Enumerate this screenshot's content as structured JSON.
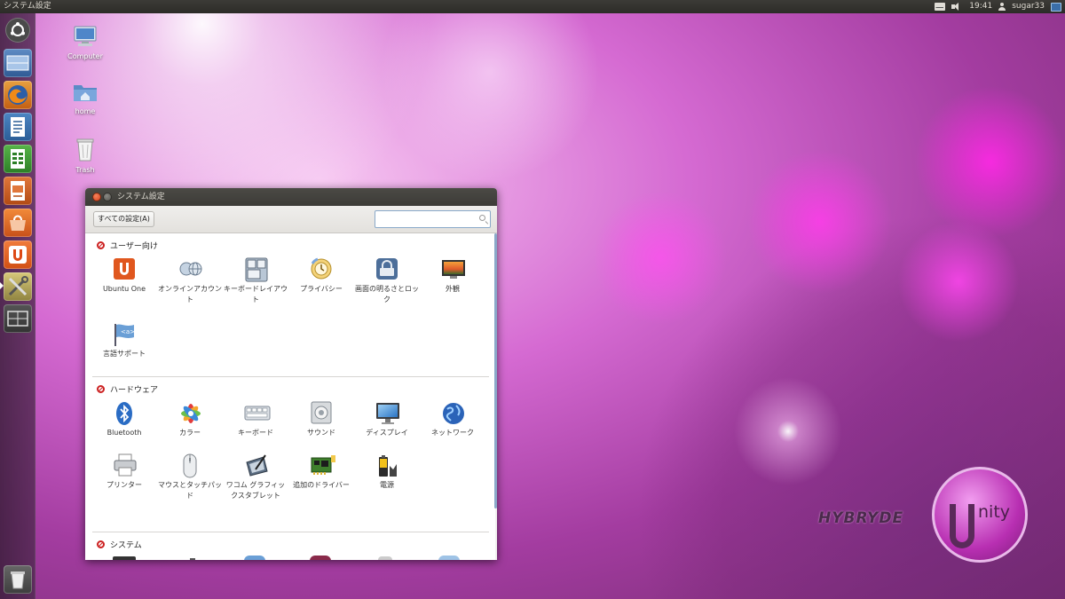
{
  "top_panel": {
    "window_title": "システム設定",
    "time": "19:41",
    "user": "sugar33"
  },
  "launcher": {
    "items": [
      {
        "name": "dash-home"
      },
      {
        "name": "workspace-switcher"
      },
      {
        "name": "firefox"
      },
      {
        "name": "libreoffice-writer"
      },
      {
        "name": "libreoffice-calc"
      },
      {
        "name": "libreoffice-impress"
      },
      {
        "name": "ubuntu-software-center"
      },
      {
        "name": "ubuntu-one"
      },
      {
        "name": "system-settings"
      },
      {
        "name": "workspaces"
      },
      {
        "name": "trash"
      }
    ]
  },
  "desktop": {
    "icons": [
      {
        "label": "Computer"
      },
      {
        "label": "home"
      },
      {
        "label": "Trash"
      }
    ],
    "logo_text": "HYBRYDE",
    "logo_word": "nity"
  },
  "window": {
    "title": "システム設定",
    "all_settings_label": "すべての設定(A)",
    "search_placeholder": "",
    "sections": [
      {
        "title": "ユーザー向け",
        "items": [
          {
            "label": "Ubuntu One",
            "icon": "ubuntu-one-icon"
          },
          {
            "label": "オンラインアカウント",
            "icon": "online-accounts-icon"
          },
          {
            "label": "キーボードレイアウト",
            "icon": "keyboard-layout-icon"
          },
          {
            "label": "プライバシー",
            "icon": "privacy-icon"
          },
          {
            "label": "画面の明るさとロック",
            "icon": "brightness-lock-icon"
          },
          {
            "label": "外観",
            "icon": "appearance-icon"
          },
          {
            "label": "言語サポート",
            "icon": "language-support-icon"
          }
        ]
      },
      {
        "title": "ハードウェア",
        "items": [
          {
            "label": "Bluetooth",
            "icon": "bluetooth-icon"
          },
          {
            "label": "カラー",
            "icon": "color-icon"
          },
          {
            "label": "キーボード",
            "icon": "keyboard-icon"
          },
          {
            "label": "サウンド",
            "icon": "sound-icon"
          },
          {
            "label": "ディスプレイ",
            "icon": "display-icon"
          },
          {
            "label": "ネットワーク",
            "icon": "network-icon"
          },
          {
            "label": "プリンター",
            "icon": "printer-icon"
          },
          {
            "label": "マウスとタッチパッド",
            "icon": "mouse-icon"
          },
          {
            "label": "ワコム グラフィックスタブレット",
            "icon": "tablet-icon"
          },
          {
            "label": "追加のドライバー",
            "icon": "drivers-icon"
          },
          {
            "label": "電源",
            "icon": "power-icon"
          }
        ]
      },
      {
        "title": "システム",
        "items": []
      }
    ]
  }
}
